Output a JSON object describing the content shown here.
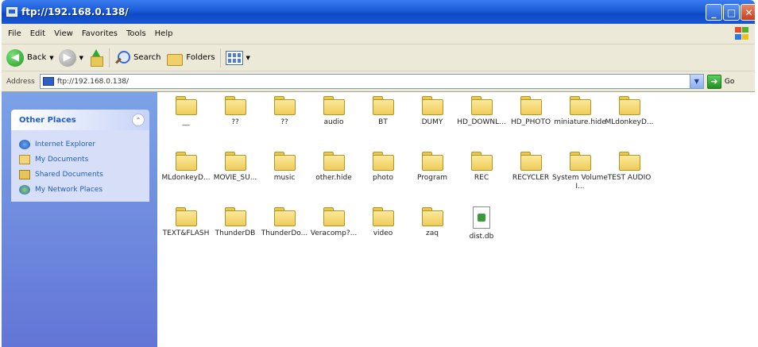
{
  "window": {
    "title": "ftp://192.168.0.138/"
  },
  "menu": [
    "File",
    "Edit",
    "View",
    "Favorites",
    "Tools",
    "Help"
  ],
  "toolbar": {
    "back_label": "Back",
    "search_label": "Search",
    "folders_label": "Folders"
  },
  "address": {
    "label": "Address",
    "value": "ftp://192.168.0.138/",
    "go_label": "Go"
  },
  "left_panel": {
    "title": "Other Places",
    "items": [
      "Internet Explorer",
      "My Documents",
      "Shared Documents",
      "My Network Places"
    ]
  },
  "files": [
    {
      "name": "__",
      "type": "folder"
    },
    {
      "name": "??",
      "type": "folder"
    },
    {
      "name": "??",
      "type": "folder"
    },
    {
      "name": "audio",
      "type": "folder"
    },
    {
      "name": "BT",
      "type": "folder"
    },
    {
      "name": "DUMY",
      "type": "folder"
    },
    {
      "name": "HD_DOWNL...",
      "type": "folder"
    },
    {
      "name": "HD_PHOTO",
      "type": "folder"
    },
    {
      "name": "miniature.hide",
      "type": "folder"
    },
    {
      "name": "MLdonkeyD...",
      "type": "folder"
    },
    {
      "name": "MLdonkeyD...",
      "type": "folder"
    },
    {
      "name": "MOVIE_SU...",
      "type": "folder"
    },
    {
      "name": "music",
      "type": "folder"
    },
    {
      "name": "other.hide",
      "type": "folder"
    },
    {
      "name": "photo",
      "type": "folder"
    },
    {
      "name": "Program",
      "type": "folder"
    },
    {
      "name": "REC",
      "type": "folder"
    },
    {
      "name": "RECYCLER",
      "type": "folder"
    },
    {
      "name": "System Volume I...",
      "type": "folder"
    },
    {
      "name": "TEST AUDIO",
      "type": "folder"
    },
    {
      "name": "TEXT&FLASH",
      "type": "folder"
    },
    {
      "name": "ThunderDB",
      "type": "folder"
    },
    {
      "name": "ThunderDo...",
      "type": "folder"
    },
    {
      "name": "Veracomp?...",
      "type": "folder"
    },
    {
      "name": "video",
      "type": "folder"
    },
    {
      "name": "zaq",
      "type": "folder"
    },
    {
      "name": "dist.db",
      "type": "file"
    }
  ],
  "colors": {
    "titlebar": "#1b5bd8",
    "sidebar": "#7ba2e7",
    "link": "#215dc6"
  }
}
